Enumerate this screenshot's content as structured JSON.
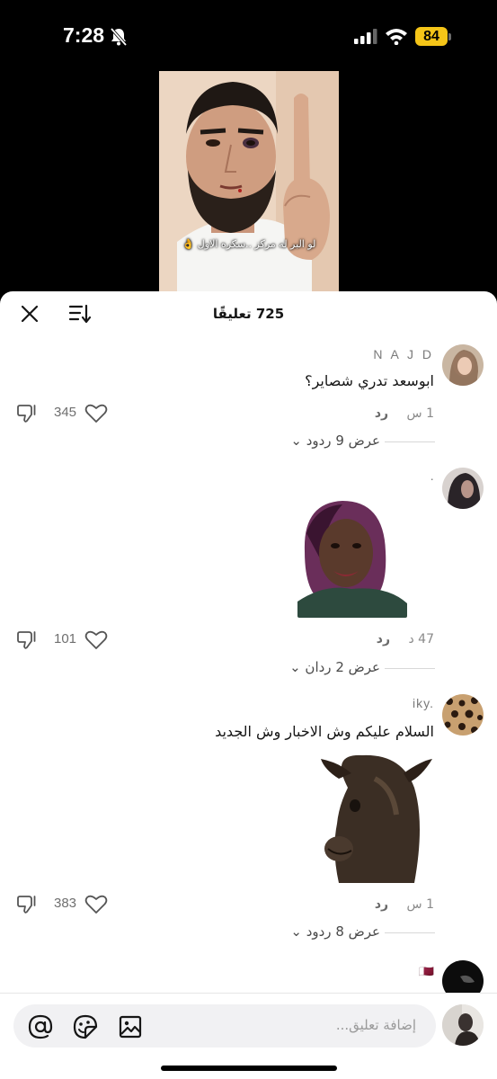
{
  "status_bar": {
    "time": "7:28",
    "battery": "84"
  },
  "video": {
    "caption": "لو البر له مركز ..سكره الاول 👌"
  },
  "sheet": {
    "comment_count_title": "725 تعليقًا"
  },
  "comments": [
    {
      "username": "N A J D",
      "text": "ابوسعد تدري شصاير؟",
      "time": "1 س",
      "reply_label": "رد",
      "likes": "345",
      "view_replies": "عرض 9 ردود ⌄"
    },
    {
      "username": "·",
      "time": "47 د",
      "reply_label": "رد",
      "likes": "101",
      "view_replies": "عرض 2 ردان ⌄"
    },
    {
      "username": "iky.",
      "text": "السلام عليكم وش الاخبار وش الجديد",
      "time": "1 س",
      "reply_label": "رد",
      "likes": "383",
      "view_replies": "عرض 8 ردود ⌄"
    },
    {
      "username": "🇶🇦"
    }
  ],
  "input": {
    "placeholder": "إضافة تعليق..."
  },
  "colors": {
    "sheet_bg": "#ffffff",
    "screen_bg": "#000000",
    "battery": "#f5c518"
  }
}
